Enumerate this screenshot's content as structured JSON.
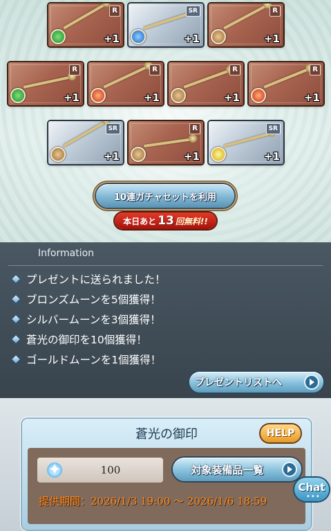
{
  "gacha_results": [
    {
      "rarity": "R",
      "element": "wind",
      "plus": "+1"
    },
    {
      "rarity": "SR",
      "element": "water",
      "plus": "+1"
    },
    {
      "rarity": "R",
      "element": "earth",
      "plus": "+1"
    },
    {
      "rarity": "R",
      "element": "wind",
      "plus": "+1"
    },
    {
      "rarity": "R",
      "element": "fire",
      "plus": "+1"
    },
    {
      "rarity": "R",
      "element": "earth",
      "plus": "+1"
    },
    {
      "rarity": "R",
      "element": "fire",
      "plus": "+1"
    },
    {
      "rarity": "SR",
      "element": "earth",
      "plus": "+1"
    },
    {
      "rarity": "R",
      "element": "earth",
      "plus": "+1"
    },
    {
      "rarity": "SR",
      "element": "light",
      "plus": "+1"
    }
  ],
  "gacha_button": {
    "label": "10連ガチャセットを利用"
  },
  "free_badge": {
    "prefix": "本日あと",
    "count": "13",
    "suffix": "回無料!!"
  },
  "information": {
    "title": "Information",
    "messages": [
      "プレゼントに送られました！",
      "ブロンズムーンを5個獲得！",
      "シルバームーンを3個獲得！",
      "蒼光の御印を10個獲得！",
      "ゴールドムーンを1個獲得！"
    ],
    "present_list_button": "プレゼントリストへ"
  },
  "item_panel": {
    "name": "蒼光の御印",
    "help_label": "HELP",
    "count": "100",
    "equip_list_button": "対象装備品一覧",
    "period": "提供期間：2026/1/3 19:00 〜 2026/1/6 18:59"
  },
  "chat": {
    "label": "Chat",
    "dots": "•••"
  },
  "colors": {
    "accent_orange": "#ff8a1e",
    "panel_dark": "#3f4c56",
    "button_blue": "#86c0dc"
  }
}
